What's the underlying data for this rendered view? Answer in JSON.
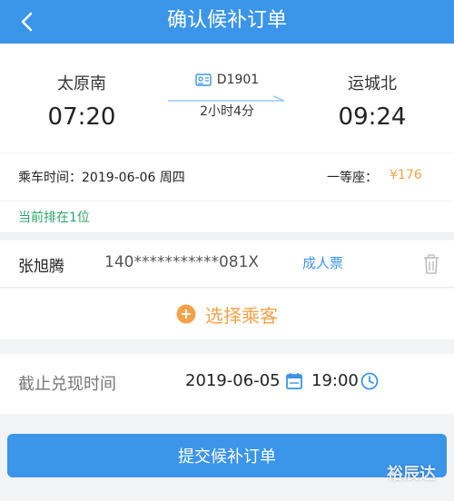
{
  "header": {
    "title": "确认候补订单",
    "back_icon": "chevron-left-icon"
  },
  "trip": {
    "from_station": "太原南",
    "departure_time": "07:20",
    "train_no": "D1901",
    "duration": "2小时4分",
    "to_station": "运城北",
    "arrival_time": "09:24"
  },
  "ride": {
    "date_label": "乘车时间：",
    "date_value": "2019-06-06 周四",
    "seat_class": "一等座：",
    "price": "¥176"
  },
  "queue": {
    "text": "当前排在1位"
  },
  "passenger": {
    "name": "张旭腾",
    "id_number": "140***********081X",
    "ticket_type": "成人票"
  },
  "add_passenger": {
    "label": "选择乘客"
  },
  "deadline": {
    "label": "截止兑现时间",
    "date": "2019-06-05",
    "time": "19:00"
  },
  "submit": {
    "label": "提交候补订单"
  },
  "watermark": {
    "text": "裕辰达"
  },
  "colors": {
    "primary": "#3b95e8",
    "accent": "#f2a34a",
    "success": "#2aa56a"
  }
}
